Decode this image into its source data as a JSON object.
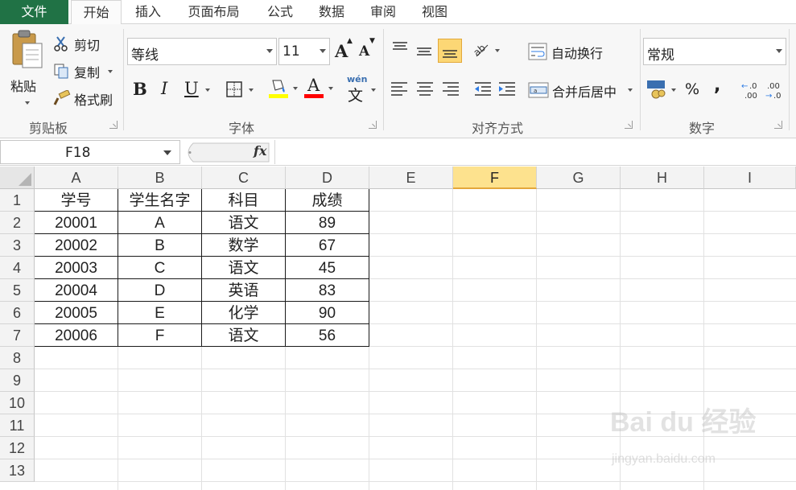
{
  "tabs": [
    "文件",
    "开始",
    "插入",
    "页面布局",
    "公式",
    "数据",
    "审阅",
    "视图"
  ],
  "clipboard": {
    "paste": "粘贴",
    "cut": "剪切",
    "copy": "复制",
    "format_painter": "格式刷",
    "group_label": "剪贴板"
  },
  "font": {
    "name": "等线",
    "size": "11",
    "grow": "A",
    "shrink": "A",
    "bold": "B",
    "italic": "I",
    "underline": "U",
    "font_color_letter": "A",
    "phonetic": "wén",
    "phonetic_char": "文",
    "group_label": "字体",
    "fill_color": "#ffff00",
    "font_color": "#ff0000"
  },
  "alignment": {
    "wrap_text": "自动换行",
    "merge_center": "合并后居中",
    "group_label": "对齐方式"
  },
  "number": {
    "format": "常规",
    "percent": "%",
    "comma": ",",
    "inc_decimal": "←.0\n.00",
    "dec_decimal": ".00\n→.0",
    "group_label": "数字"
  },
  "formula_bar": {
    "name_box": "F18",
    "fx": "fx",
    "content": ""
  },
  "grid": {
    "columns": [
      "A",
      "B",
      "C",
      "D",
      "E",
      "F",
      "G",
      "H",
      "I"
    ],
    "selected_column": "F",
    "rows": [
      "1",
      "2",
      "3",
      "4",
      "5",
      "6",
      "7",
      "8",
      "9",
      "10",
      "11",
      "12",
      "13"
    ],
    "table": [
      [
        "学号",
        "学生名字",
        "科目",
        "成绩"
      ],
      [
        "20001",
        "A",
        "语文",
        "89"
      ],
      [
        "20002",
        "B",
        "数学",
        "67"
      ],
      [
        "20003",
        "C",
        "语文",
        "45"
      ],
      [
        "20004",
        "D",
        "英语",
        "83"
      ],
      [
        "20005",
        "E",
        "化学",
        "90"
      ],
      [
        "20006",
        "F",
        "语文",
        "56"
      ]
    ]
  },
  "watermark": {
    "brand": "Bai du 经验",
    "url": "jingyan.baidu.com"
  },
  "colors": {
    "file_tab": "#207245",
    "selection": "#217346",
    "header_highlight": "#fde28e"
  }
}
